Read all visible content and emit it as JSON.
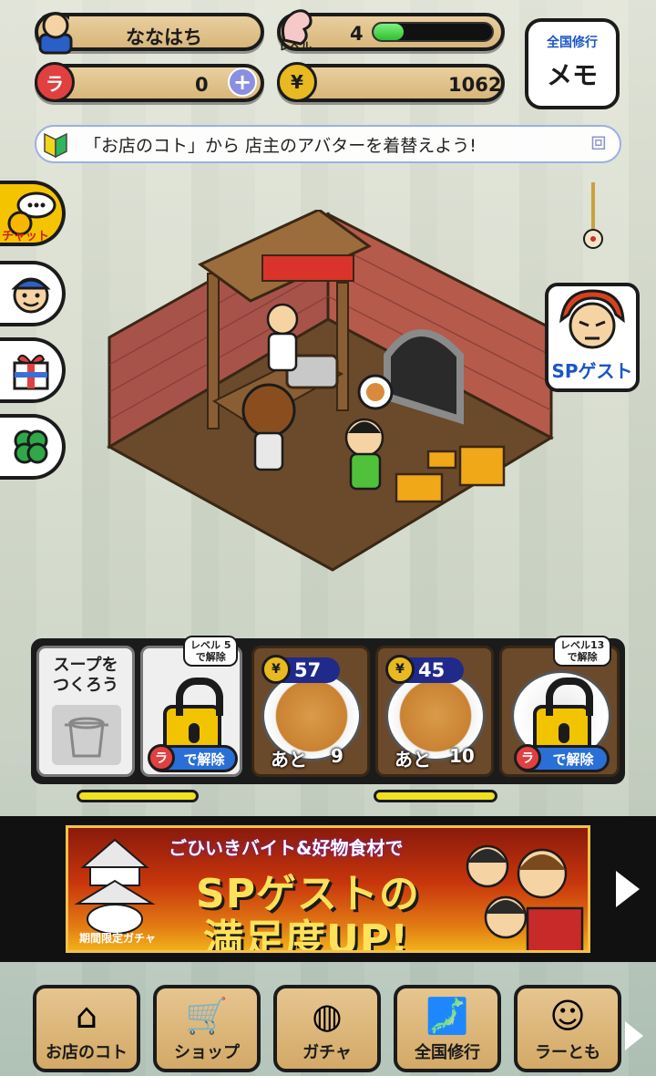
{
  "status": {
    "player_name": "ななはち",
    "level_label": "レベル",
    "level": "4",
    "level_progress": 0.25,
    "ramen_tickets": "0",
    "coins": "1062",
    "memo_top": "全国修行",
    "memo_bottom": "メモ"
  },
  "tip": "「お店のコト」から 店主のアバターを着替えよう!",
  "side_menu": {
    "chat_label": "チャット"
  },
  "sp_guest_label": "SPゲスト",
  "soups": [
    {
      "title": "スープをつくろう"
    },
    {
      "level_req": "レベル 5\nで解除",
      "unlock_label": "で解除"
    },
    {
      "price": "57",
      "remaining_label": "あと",
      "remaining": "9"
    },
    {
      "price": "45",
      "remaining_label": "あと",
      "remaining": "10"
    },
    {
      "level_req": "レベル13\nで解除",
      "unlock_label": "で解除"
    }
  ],
  "banner": {
    "line1": "ごひいきバイト&好物食材で",
    "line2": "SPゲストの",
    "line3": "満足度UP!",
    "sub": "期間限定ガチャ"
  },
  "nav": [
    {
      "label": "お店のコト",
      "icon": "house-icon"
    },
    {
      "label": "ショップ",
      "icon": "cart-icon"
    },
    {
      "label": "ガチャ",
      "icon": "gacha-icon"
    },
    {
      "label": "全国修行",
      "icon": "map-icon"
    },
    {
      "label": "ラーとも",
      "icon": "friend-icon"
    }
  ],
  "colors": {
    "accent_blue": "#1f2a8a",
    "lock_yellow": "#f2c400",
    "wood": "#d8b67a"
  }
}
